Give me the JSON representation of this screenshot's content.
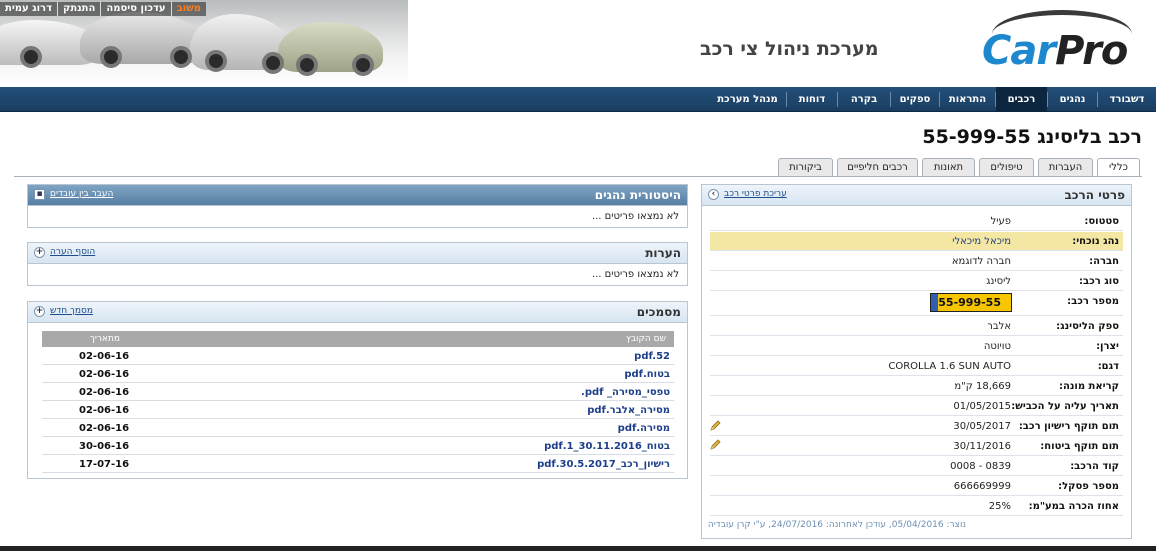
{
  "header": {
    "top_links": [
      "משוב",
      "עדכון סיסמה",
      "התנתק",
      "דרוג עמית"
    ],
    "system_title": "מערכת ניהול צי רכב",
    "logo": {
      "part1": "Car",
      "part2": "Pro"
    }
  },
  "nav": {
    "items": [
      "דשבורד",
      "נהגים",
      "רכבים",
      "התראות",
      "ספקים",
      "בקרה",
      "דוחות",
      "מנהל מערכת"
    ],
    "active": "רכבים"
  },
  "page_title": "רכב בליסינג 55-999-55",
  "tabs": [
    "כללי",
    "העברות",
    "טיפולים",
    "תאונות",
    "רכבים חליפיים",
    "ביקורות"
  ],
  "details": {
    "title": "פרטי הרכב",
    "edit_link": "עריכת פרטי רכב",
    "rows": [
      {
        "label": "סטטוס:",
        "value": "פעיל"
      },
      {
        "label": "נהג נוכחי:",
        "value": "מיכאל מיכאלי"
      },
      {
        "label": "חברה:",
        "value": "חברה לדוגמא"
      },
      {
        "label": "סוג רכב:",
        "value": "ליסינג"
      },
      {
        "label": "מספר רכב:",
        "value": "55-999-55"
      },
      {
        "label": "ספק הליסינג:",
        "value": "אלבר"
      },
      {
        "label": "יצרן:",
        "value": "טויוטה"
      },
      {
        "label": "דגם:",
        "value": "COROLLA 1.6 SUN AUTO"
      },
      {
        "label": "קריאת מונה:",
        "value": "18,669 ק\"מ"
      },
      {
        "label": "תאריך עליה על הכביש:",
        "value": "01/05/2015"
      },
      {
        "label": "תום תוקף רישיון רכב:",
        "value": "30/05/2017"
      },
      {
        "label": "תום תוקף ביטוח:",
        "value": "30/11/2016"
      },
      {
        "label": "קוד הרכב:",
        "value": "0839 - 0008"
      },
      {
        "label": "מספר פסקל:",
        "value": "666669999"
      },
      {
        "label": "אחוז הכרה במע\"מ:",
        "value": "25%"
      }
    ],
    "note": "נוצר: 05/04/2016, עודכן לאחרונה: 24/07/2016, ע\"י קרן עובדיה"
  },
  "history": {
    "title": "היסטורית נהגים",
    "link": "העבר בין עובדים",
    "empty": "לא נמצאו פריטים ..."
  },
  "remarks": {
    "title": "הערות",
    "link": "הוסף הערה",
    "empty": "לא נמצאו פריטים ..."
  },
  "documents": {
    "title": "מסמכים",
    "link": "מסמך חדש",
    "columns": {
      "name": "שם הקובץ",
      "date": "מתאריך"
    },
    "rows": [
      {
        "name": "pdf.52",
        "date": "02-06-16"
      },
      {
        "name": "בטוח.pdf",
        "date": "02-06-16"
      },
      {
        "name": "טפסי_מסירה_ pdf.",
        "date": "02-06-16"
      },
      {
        "name": "מסירה_אלבר.pdf",
        "date": "02-06-16"
      },
      {
        "name": "מסירה.pdf",
        "date": "02-06-16"
      },
      {
        "name": "בטוח_30.11.2016_1.pdf",
        "date": "30-06-16"
      },
      {
        "name": "רישיון_רכב_30.5.2017.pdf",
        "date": "17-07-16"
      }
    ]
  },
  "colors": {
    "nav_bg": "#1a3e62",
    "highlight_row": "#f4e7a3",
    "plate": "#f7c600",
    "logo_blue": "#1e88cf"
  }
}
